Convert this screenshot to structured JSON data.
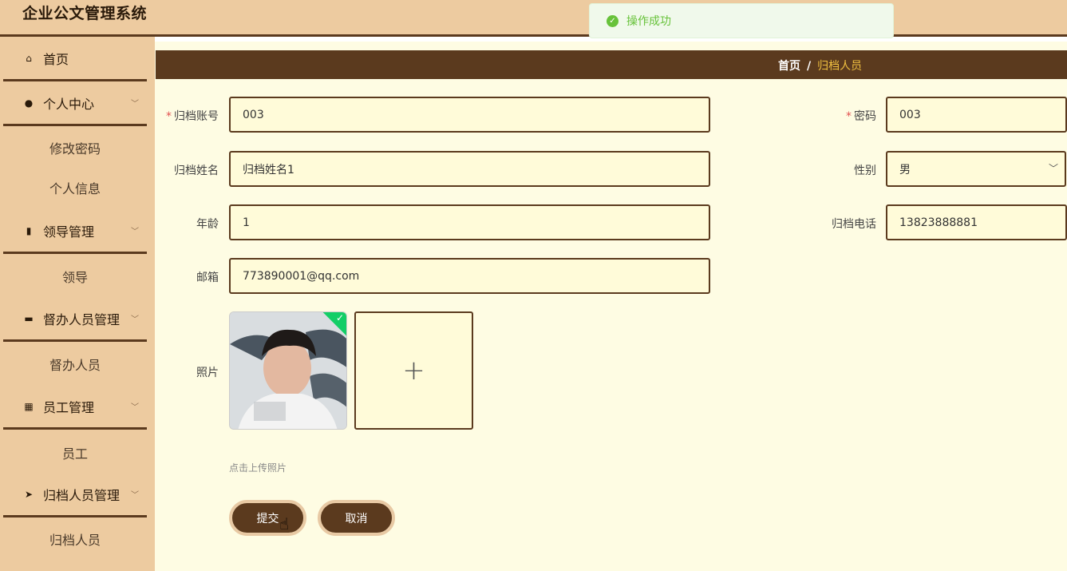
{
  "app": {
    "title": "企业公文管理系统"
  },
  "toast": {
    "text": "操作成功"
  },
  "sidebar": {
    "menus": [
      {
        "label": "首页",
        "icon": "home-icon",
        "glyph": "⌂",
        "has_children": false
      },
      {
        "label": "个人中心",
        "icon": "user-icon",
        "glyph": "●",
        "has_children": true,
        "children": [
          "修改密码",
          "个人信息"
        ]
      },
      {
        "label": "领导管理",
        "icon": "books-icon",
        "glyph": "▮",
        "has_children": true,
        "children": [
          "领导"
        ]
      },
      {
        "label": "督办人员管理",
        "icon": "briefcase-icon",
        "glyph": "▬",
        "has_children": true,
        "children": [
          "督办人员"
        ]
      },
      {
        "label": "员工管理",
        "icon": "grid-icon",
        "glyph": "▦",
        "has_children": true,
        "children": [
          "员工"
        ]
      },
      {
        "label": "归档人员管理",
        "icon": "send-icon",
        "glyph": "➤",
        "has_children": true,
        "children": [
          "归档人员"
        ]
      }
    ]
  },
  "breadcrumb": {
    "home": "首页",
    "separator": "/",
    "current": "归档人员"
  },
  "form": {
    "account": {
      "label": "归档账号",
      "value": "003",
      "required": true
    },
    "password": {
      "label": "密码",
      "value": "003",
      "required": true
    },
    "name": {
      "label": "归档姓名",
      "value": "归档姓名1"
    },
    "gender": {
      "label": "性别",
      "value": "男"
    },
    "age": {
      "label": "年龄",
      "value": "1"
    },
    "phone": {
      "label": "归档电话",
      "value": "13823888881"
    },
    "email": {
      "label": "邮箱",
      "value": "773890001@qq.com"
    },
    "photo": {
      "label": "照片",
      "upload_tip": "点击上传照片"
    }
  },
  "buttons": {
    "submit": "提交",
    "cancel": "取消"
  },
  "colors": {
    "brand_dark": "#5b3a1e",
    "sidebar_bg": "#edcba0",
    "content_bg": "#fefce3",
    "success": "#67c23a",
    "accent": "#f0c040"
  }
}
